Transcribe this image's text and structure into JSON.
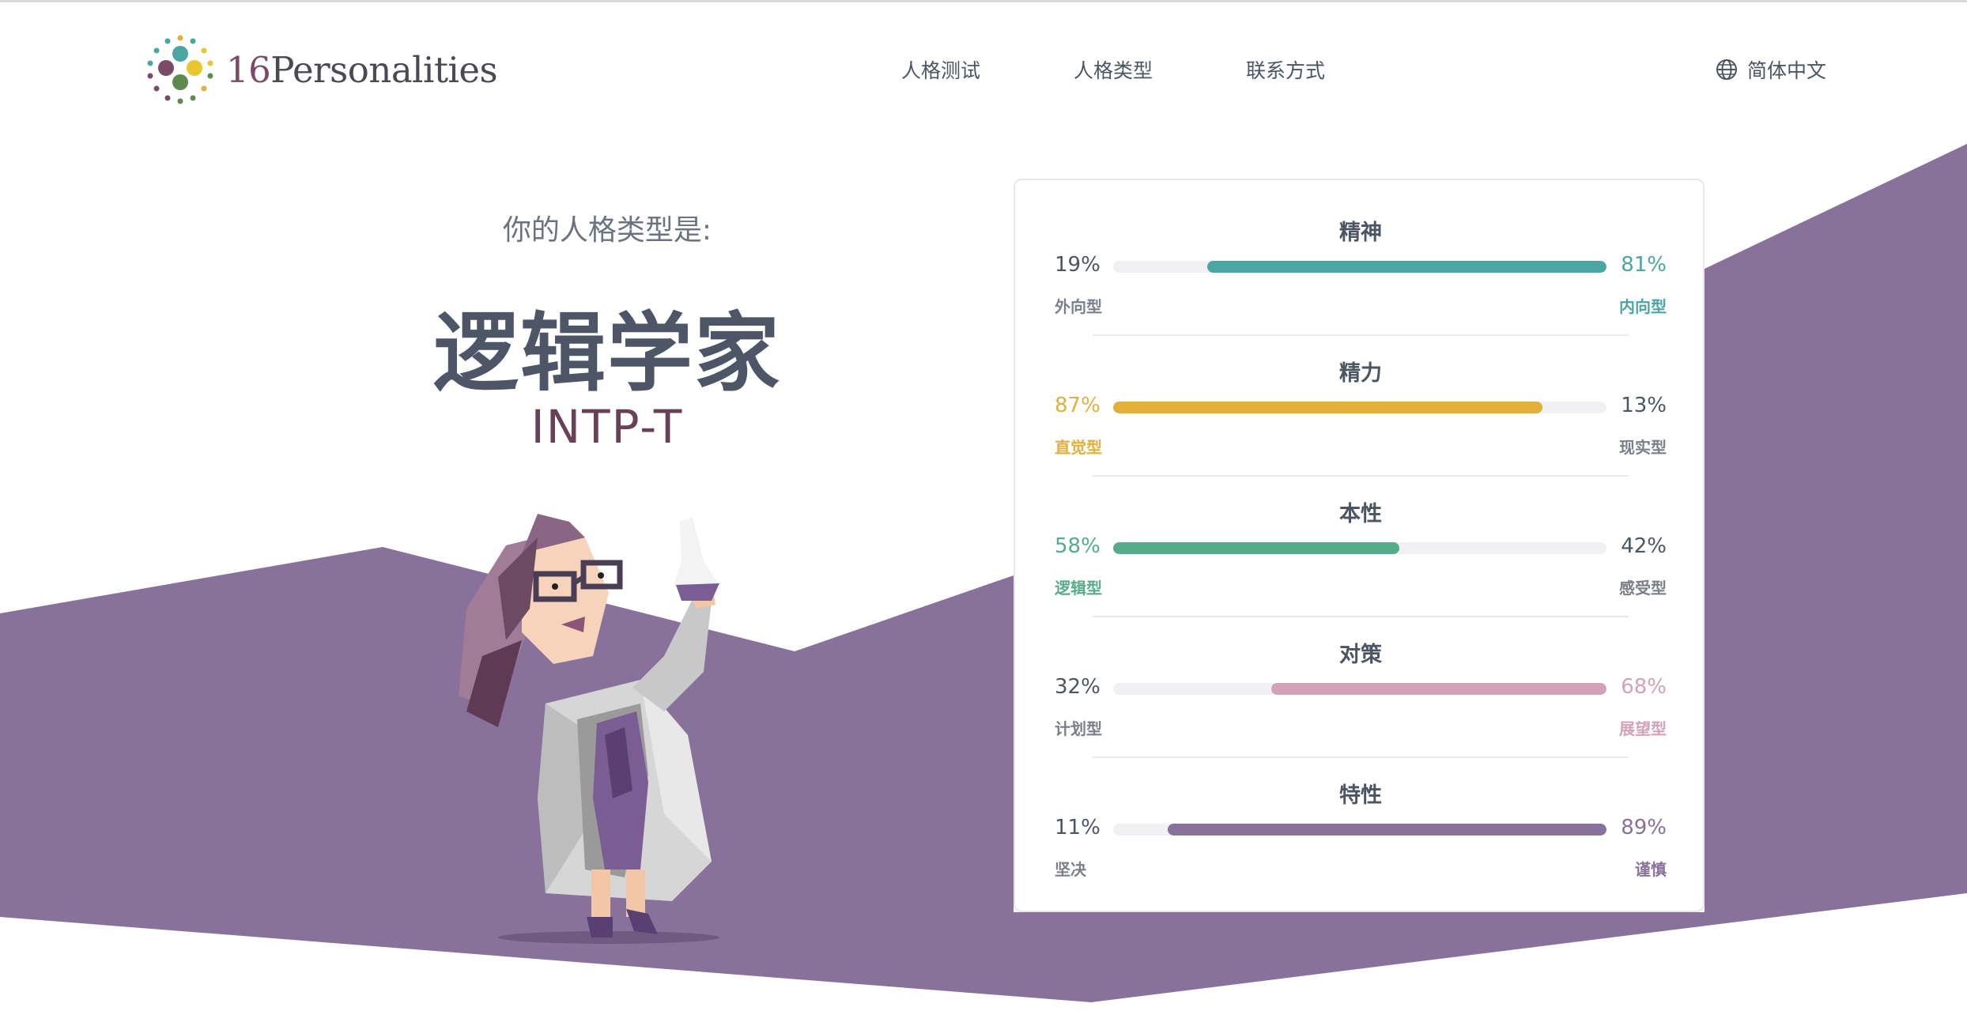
{
  "header": {
    "logo_number": "16",
    "logo_word": "Personalities",
    "nav": [
      "人格测试",
      "人格类型",
      "联系方式"
    ],
    "language": "简体中文"
  },
  "hero": {
    "subtitle": "你的人格类型是:",
    "type_name": "逻辑学家",
    "type_code": "INTP-T"
  },
  "colors": {
    "purple": "#88719a",
    "mind": "#4aa5a3",
    "energy": "#e4ae3a",
    "nature": "#56ac8a",
    "tactics": "#d4a2b8",
    "identity": "#88719a"
  },
  "traits": [
    {
      "title": "精神",
      "left_pct": "19%",
      "right_pct": "81%",
      "left_label": "外向型",
      "right_label": "内向型",
      "dominant": "right",
      "fill_fraction": 0.81,
      "color": "#4aa5a3"
    },
    {
      "title": "精力",
      "left_pct": "87%",
      "right_pct": "13%",
      "left_label": "直觉型",
      "right_label": "现实型",
      "dominant": "left",
      "fill_fraction": 0.87,
      "color": "#e4ae3a"
    },
    {
      "title": "本性",
      "left_pct": "58%",
      "right_pct": "42%",
      "left_label": "逻辑型",
      "right_label": "感受型",
      "dominant": "left",
      "fill_fraction": 0.58,
      "color": "#56ac8a"
    },
    {
      "title": "对策",
      "left_pct": "32%",
      "right_pct": "68%",
      "left_label": "计划型",
      "right_label": "展望型",
      "dominant": "right",
      "fill_fraction": 0.68,
      "color": "#d4a2b8"
    },
    {
      "title": "特性",
      "left_pct": "11%",
      "right_pct": "89%",
      "left_label": "坚决",
      "right_label": "谨慎",
      "dominant": "right",
      "fill_fraction": 0.89,
      "color": "#88719a"
    }
  ]
}
